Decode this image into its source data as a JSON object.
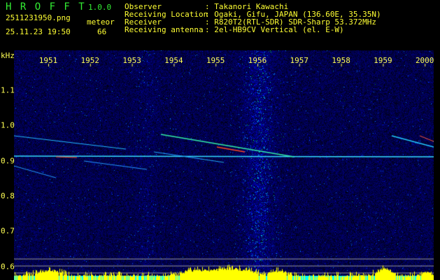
{
  "app": {
    "name": "H R O F F T",
    "version": "1.0.0"
  },
  "file": {
    "name": "2511231950.png",
    "datetime": "25.11.23 19:50"
  },
  "meteor": {
    "label": "meteor",
    "count": "66"
  },
  "info": [
    {
      "key": "Observer",
      "value": "Takanori Kawachi"
    },
    {
      "key": "Receiving Location",
      "value": "Ogaki, Gifu, JAPAN (136.60E, 35.35N)"
    },
    {
      "key": "Receiver",
      "value": "R820T2(RTL-SDR) SDR-Sharp 53.372MHz"
    },
    {
      "key": "Receiving antenna",
      "value": "2el-HB9CV Vertical (el. E-W)"
    }
  ],
  "colors": {
    "text": "#ffff33",
    "title": "#33ee33",
    "background": "#000000",
    "noise": "#10108a",
    "signal": "#00ffff",
    "level": "#ffff00"
  },
  "chart_data": {
    "type": "heatmap",
    "ylabel": "kHz",
    "x_ticks": [
      "1951",
      "1952",
      "1953",
      "1954",
      "1955",
      "1956",
      "1957",
      "1958",
      "1959",
      "2000"
    ],
    "y_ticks": [
      "1.1",
      "1.0",
      "0.9",
      "0.8",
      "0.7",
      "0.6"
    ],
    "ylim": [
      0.56,
      1.19
    ],
    "carrier_khz": 0.91
  }
}
